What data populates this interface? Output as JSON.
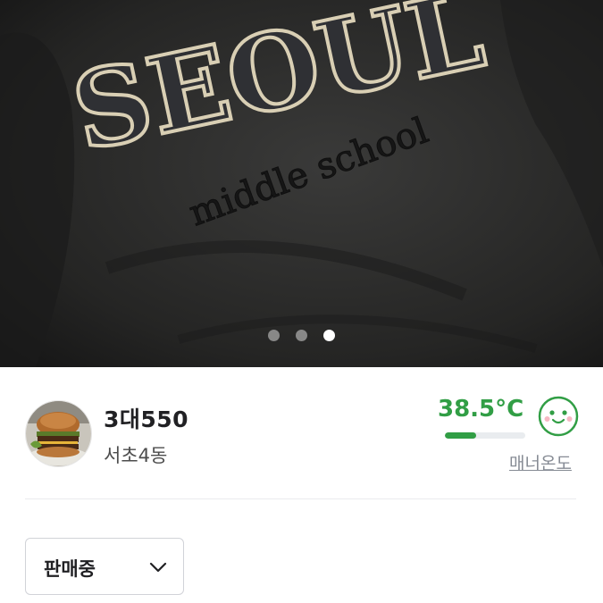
{
  "carousel": {
    "photo_text": {
      "arch": "SEOUL",
      "sub": "middle school"
    },
    "dots": [
      {
        "active": false
      },
      {
        "active": false
      },
      {
        "active": true
      }
    ]
  },
  "seller": {
    "nickname": "3대550",
    "region": "서초4동",
    "avatar": "burger-photo"
  },
  "manner": {
    "temperature_text": "38.5°C",
    "temperature_level_percent": 38.5,
    "label": "매너온도",
    "icon": "smiley-face-icon",
    "color": "#319e45"
  },
  "status": {
    "selected": "판매중",
    "icon": "chevron-down-icon"
  }
}
